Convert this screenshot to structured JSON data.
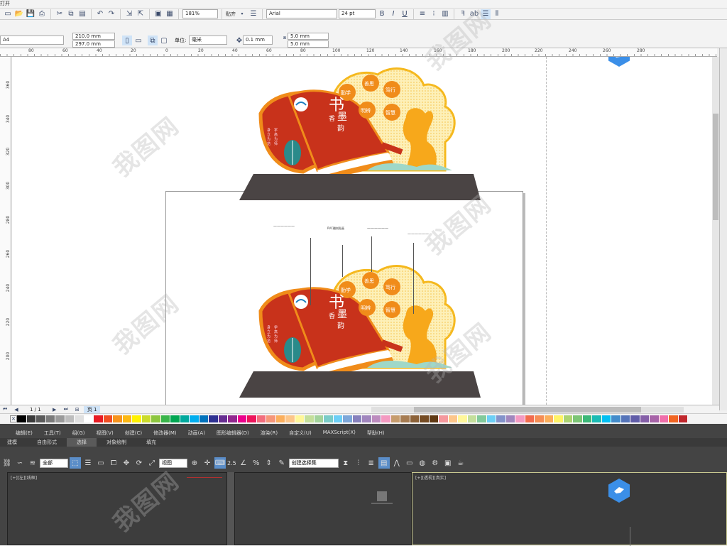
{
  "toolbar": {
    "file_label": "打开",
    "zoom": "181%",
    "snap_label": "贴齐",
    "font": "Arial",
    "font_size": "24 pt"
  },
  "props": {
    "page_size": "A4",
    "width": "210.0 mm",
    "height": "297.0 mm",
    "unit_label": "单位:",
    "unit": "毫米",
    "nudge": "0.1 mm",
    "dup_x": "5.0 mm",
    "dup_y": "5.0 mm"
  },
  "ruler": {
    "top": [
      "80",
      "60",
      "40",
      "20",
      "0",
      "20",
      "40",
      "60",
      "80",
      "100",
      "120",
      "140",
      "160",
      "180",
      "200",
      "220",
      "240",
      "260",
      "280"
    ],
    "left": [
      "360",
      "340",
      "320",
      "300",
      "280",
      "260",
      "240",
      "220",
      "200"
    ]
  },
  "canvas": {
    "sign_title": "书",
    "sign_sub1": "香",
    "sign_sub2": "墨",
    "sign_sub3": "韵",
    "circles_top": [
      "勤学",
      "善思",
      "笃行",
      "明辨",
      "智慧"
    ],
    "circles_bottom": [
      "勤学",
      "善思",
      "笃行",
      "明辨",
      "智慧"
    ],
    "left_verse": "身·立·为·范",
    "left_verse2": "学·高·为·师",
    "annotations": [
      "——————",
      "PVC雕刻贴画",
      "——————",
      "——————"
    ]
  },
  "pager": {
    "pos": "1 / 1",
    "page_tab": "页 1"
  },
  "palette": [
    "#000000",
    "#3a3a3a",
    "#5a5a5a",
    "#7a7a7a",
    "#9a9a9a",
    "#bdbdbd",
    "#e0e0e0",
    "#ffffff",
    "#e81c24",
    "#f04e23",
    "#f7941d",
    "#fcb813",
    "#fff200",
    "#cbdb2a",
    "#8dc63f",
    "#39b54a",
    "#00a651",
    "#00a99d",
    "#00aeef",
    "#0072bc",
    "#2e3192",
    "#662d91",
    "#92278f",
    "#ec008c",
    "#ed145b",
    "#f26d7d",
    "#f69679",
    "#fbaf5d",
    "#fdc689",
    "#fff799",
    "#c4df9b",
    "#a3d39c",
    "#7accc8",
    "#6dcff6",
    "#7da7d9",
    "#8781bd",
    "#a186be",
    "#bd8cbf",
    "#f49ac1",
    "#c69c6d",
    "#a67c52",
    "#8c6239",
    "#754c24",
    "#603913",
    "#f5989d",
    "#fdc68a",
    "#fff79a",
    "#c4df9b",
    "#82ca9c",
    "#6ccff6",
    "#8393ca",
    "#a187be",
    "#f49ac2",
    "#f26c4f",
    "#f68e56",
    "#fbaf5c",
    "#fff467",
    "#acd372",
    "#7cc576",
    "#3bb878",
    "#1abbb4",
    "#00bff3",
    "#438ccb",
    "#5574b9",
    "#605ca8",
    "#855fa8",
    "#a763a8",
    "#f06eaa",
    "#f26522",
    "#c1272d"
  ],
  "max": {
    "menu": [
      "编辑(E)",
      "工具(T)",
      "组(G)",
      "视图(V)",
      "创建(C)",
      "修改器(M)",
      "动画(A)",
      "图形编辑器(D)",
      "渲染(R)",
      "自定义(U)",
      "MAXScript(X)",
      "帮助(H)"
    ],
    "ribbon": [
      "建模",
      "自由形式",
      "选择",
      "对象绘制",
      "填充"
    ],
    "filter": "全部",
    "view_dd": "视图",
    "selset": "创建选择集",
    "snap_val": "2.5",
    "vp_left": "[+][左][线框]",
    "vp_right": "[+][透视][真实]"
  },
  "watermark": "我图网"
}
